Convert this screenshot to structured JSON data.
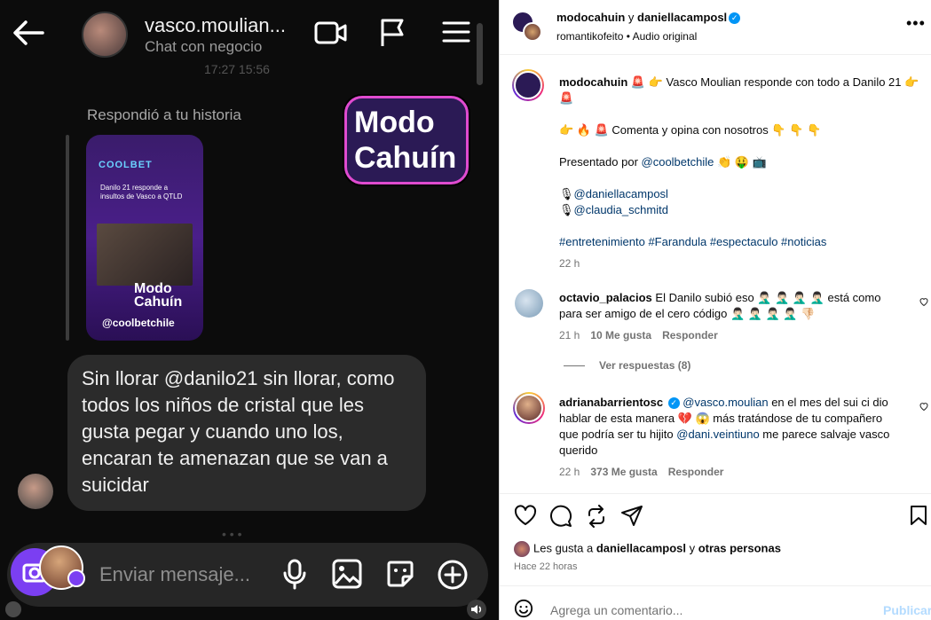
{
  "dm": {
    "username": "vasco.moulian...",
    "subtitle": "Chat con negocio",
    "timestamp": "17:27 15:56",
    "replied_to": "Respondió a tu historia",
    "story_brand": "COOLBET",
    "story_headline": "Danilo 21 responde a insultos de Vasco a QTLD",
    "story_logo_line1": "Modo",
    "story_logo_line2": "Cahuín",
    "story_handle": "@coolbetchile",
    "logo_line1": "Modo",
    "logo_line2": "Cahuín",
    "message": "Sin llorar @danilo21 sin llorar, como todos los niños de cristal que les gusta pegar y cuando uno los, encaran te amenazan que se van a suicidar",
    "composer_placeholder": "Enviar mensaje..."
  },
  "header": {
    "user1": "modocahuin",
    "connector": " y ",
    "user2": "daniellacamposl",
    "sub_user": "romantikofeito",
    "sub_sep": " • ",
    "sub_audio": "Audio original",
    "more_icon": "more-horizontal-icon"
  },
  "caption": {
    "username": "modocahuin",
    "line1_emoji_a": "🚨 👉",
    "line1_text": " Vasco Moulian responde con todo a Danilo 21 ",
    "line1_emoji_b": "👉 🚨",
    "line2_emoji": "👉 🔥 🚨",
    "line2_text": " Comenta y opina con nosotros ",
    "line2_emoji_b": "👇 👇 👇",
    "presented": "Presentado por ",
    "presented_link": "@coolbetchile",
    "presented_emoji": " 👏 🤑 📺",
    "mention1": "@daniellacamposl",
    "mention2": "@claudia_schmitd",
    "hashtags": "#entretenimiento #Farandula #espectaculo #noticias",
    "time": "22 h"
  },
  "comments": [
    {
      "username": "octavio_palacios",
      "text": " El Danilo subió eso 🤦🏻‍♂️ 🤦🏻‍♂️ 🤦🏻‍♂️ 🤦🏻‍♂️ está como para ser amigo de el cero código 🤦🏻‍♂️ 🤦🏻‍♂️ 🤦🏻‍♂️ 🤦🏻‍♂️ 👎🏻",
      "time": "21 h",
      "likes": "10 Me gusta",
      "reply": "Responder"
    },
    {
      "username": "adrianabarrientosc",
      "mention": "@vasco.moulian",
      "text_a": " en el mes del sui ci dio hablar de esta manera 💔 😱 más tratándose de tu compañero que podría ser tu hijito ",
      "mention2": "@dani.veintiuno",
      "text_b": " me parece salvaje vasco querido",
      "time": "22 h",
      "likes": "373 Me gusta",
      "reply": "Responder"
    }
  ],
  "view_replies": "Ver respuestas (8)",
  "likes_line": {
    "prefix": "Les gusta a ",
    "user": "daniellacamposl",
    "mid": " y ",
    "others": "otras personas"
  },
  "posted_ago": "Hace 22 horas",
  "add_comment": {
    "placeholder": "Agrega un comentario...",
    "publish": "Publicar"
  },
  "colors": {
    "link": "#00376b",
    "verified": "#0095f6",
    "publish_disabled": "#b3dbff",
    "dm_bg": "#0c0c0c",
    "bubble": "#2b2b2b"
  }
}
